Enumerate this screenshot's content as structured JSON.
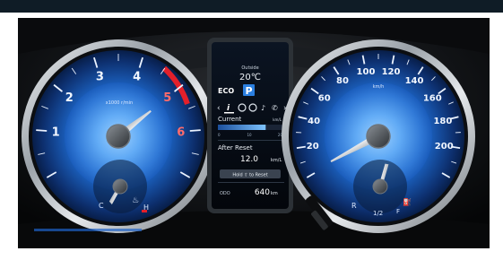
{
  "gauges": {
    "tachometer": {
      "labels": [
        "1",
        "2",
        "3",
        "4",
        "5",
        "6"
      ],
      "unit": "x1000 r/min",
      "redline_from": 5
    },
    "speedometer": {
      "labels": [
        "20",
        "40",
        "60",
        "80",
        "100",
        "120",
        "140",
        "160",
        "180",
        "200"
      ],
      "unit": "km/h",
      "max": 220
    },
    "temperature": {
      "low": "C",
      "high": "H"
    },
    "fuel": {
      "empty": "R",
      "half": "1/2",
      "full": "F"
    }
  },
  "display": {
    "outside_label": "Outside",
    "outside_temp": "20℃",
    "eco": "ECO",
    "parking": "P",
    "current_label": "Current",
    "current_unit": "km/L",
    "current_level": 0.72,
    "current_scale": [
      "0",
      "10",
      "20"
    ],
    "after_reset_label": "After Reset",
    "after_reset_value": "12.0",
    "after_reset_unit": "km/L",
    "hold_hint": "Hold ⇧ to Reset",
    "odometer": "640",
    "odometer_unit": "km"
  },
  "colors": {
    "gauge_blue": "#1e63c8",
    "redline": "#e3202a",
    "parking_indicator": "#2b7fe0"
  }
}
